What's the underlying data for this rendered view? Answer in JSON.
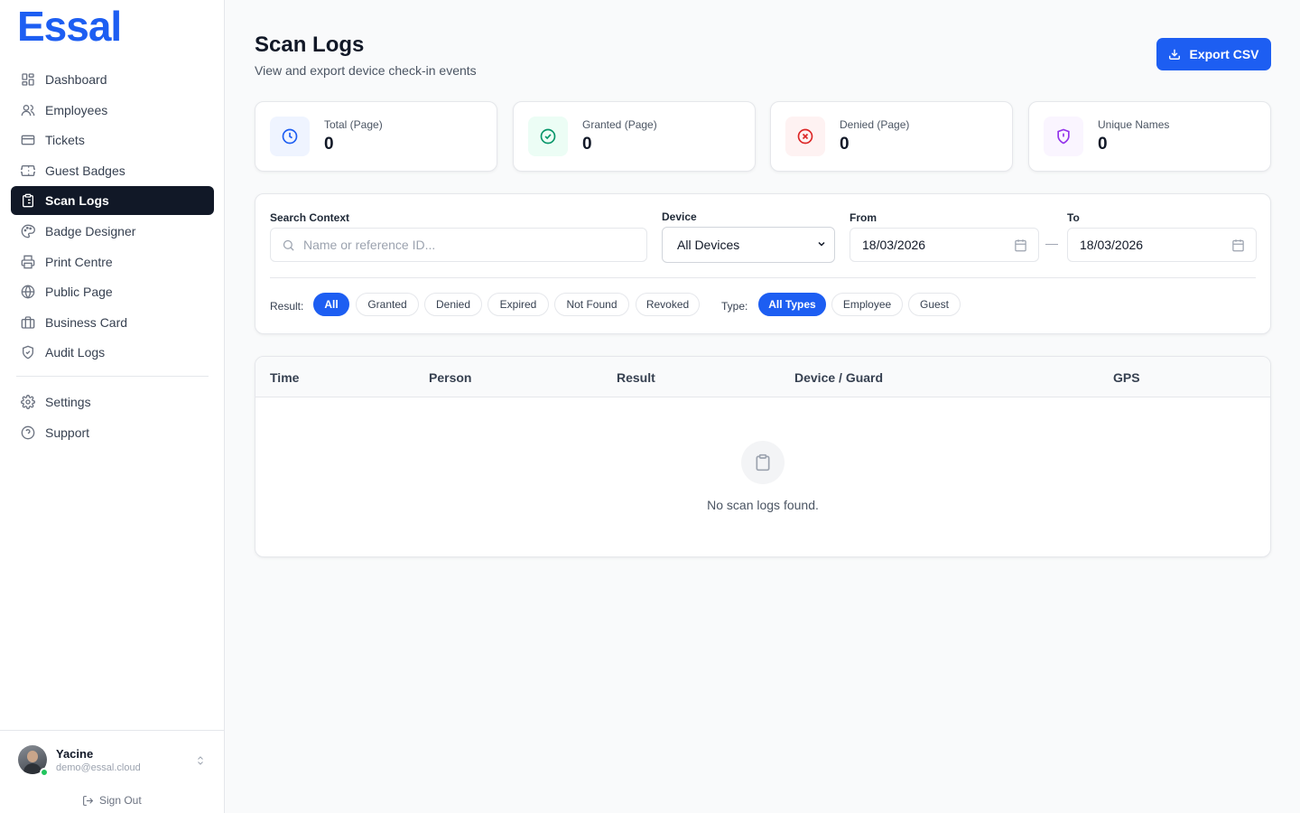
{
  "brand": {
    "logo": "Essal",
    "accent": "#1d5ef2"
  },
  "sidebar": {
    "items": [
      {
        "label": "Dashboard",
        "icon": "dashboard-icon",
        "active": false
      },
      {
        "label": "Employees",
        "icon": "users-icon",
        "active": false
      },
      {
        "label": "Tickets",
        "icon": "ticket-icon",
        "active": false
      },
      {
        "label": "Guest Badges",
        "icon": "badge-icon",
        "active": false
      },
      {
        "label": "Scan Logs",
        "icon": "clipboard-list-icon",
        "active": true
      },
      {
        "label": "Badge Designer",
        "icon": "palette-icon",
        "active": false
      },
      {
        "label": "Print Centre",
        "icon": "printer-icon",
        "active": false
      },
      {
        "label": "Public Page",
        "icon": "globe-icon",
        "active": false
      },
      {
        "label": "Business Card",
        "icon": "briefcase-icon",
        "active": false
      },
      {
        "label": "Audit Logs",
        "icon": "shield-icon",
        "active": false
      }
    ],
    "secondary": [
      {
        "label": "Settings",
        "icon": "gear-icon"
      },
      {
        "label": "Support",
        "icon": "help-circle-icon"
      }
    ],
    "user": {
      "name": "Yacine",
      "email": "demo@essal.cloud",
      "status": "online"
    },
    "sign_out": "Sign Out"
  },
  "header": {
    "title": "Scan Logs",
    "subtitle": "View and export device check-in events",
    "export_label": "Export CSV"
  },
  "stats": [
    {
      "label": "Total (Page)",
      "value": "0",
      "icon": "clock-icon",
      "color": "#1d5ef2",
      "bg": "#eff4ff"
    },
    {
      "label": "Granted (Page)",
      "value": "0",
      "icon": "check-circle-icon",
      "color": "#059669",
      "bg": "#ecfdf5"
    },
    {
      "label": "Denied (Page)",
      "value": "0",
      "icon": "x-circle-icon",
      "color": "#dc2626",
      "bg": "#fef2f2"
    },
    {
      "label": "Unique Names",
      "value": "0",
      "icon": "shield-alert-icon",
      "color": "#9333ea",
      "bg": "#faf5ff"
    }
  ],
  "filters": {
    "search_label": "Search Context",
    "search_placeholder": "Name or reference ID...",
    "device_label": "Device",
    "device_value": "All Devices",
    "from_label": "From",
    "from_value": "18/03/2026",
    "to_label": "To",
    "to_value": "18/03/2026",
    "separator": "—",
    "result_label": "Result:",
    "result_chips": [
      "All",
      "Granted",
      "Denied",
      "Expired",
      "Not Found",
      "Revoked"
    ],
    "result_selected": "All",
    "type_label": "Type:",
    "type_chips": [
      "All Types",
      "Employee",
      "Guest"
    ],
    "type_selected": "All Types"
  },
  "table": {
    "columns": [
      "Time",
      "Person",
      "Result",
      "Device / Guard",
      "GPS"
    ],
    "rows": [],
    "empty_text": "No scan logs found."
  }
}
